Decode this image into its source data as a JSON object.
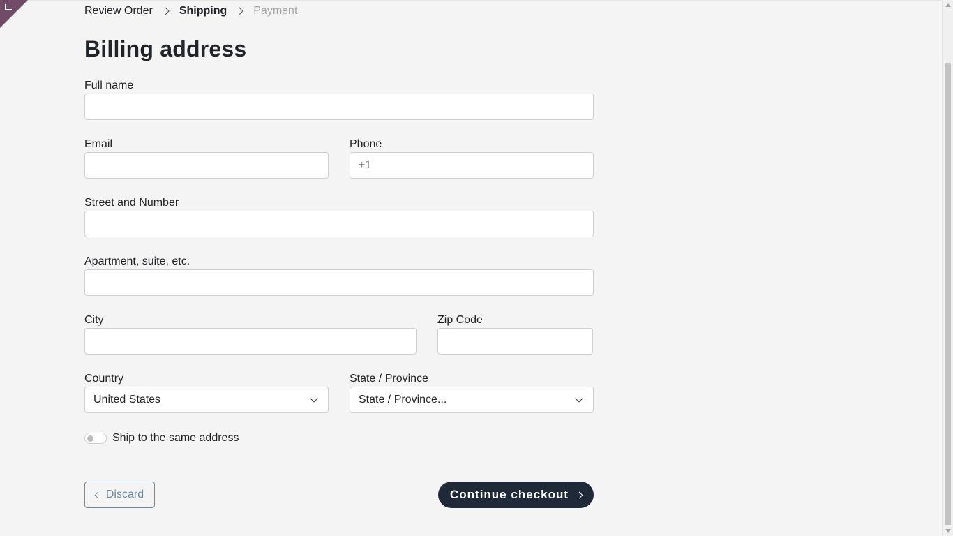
{
  "breadcrumb": {
    "items": [
      {
        "label": "Review Order"
      },
      {
        "label": "Shipping"
      },
      {
        "label": "Payment"
      }
    ]
  },
  "form": {
    "title": "Billing address",
    "full_name": {
      "label": "Full name",
      "value": "",
      "placeholder": ""
    },
    "email": {
      "label": "Email",
      "value": "",
      "placeholder": ""
    },
    "phone": {
      "label": "Phone",
      "value": "",
      "placeholder": "+1"
    },
    "street": {
      "label": "Street and Number",
      "value": "",
      "placeholder": ""
    },
    "apartment": {
      "label": "Apartment, suite, etc.",
      "value": "",
      "placeholder": ""
    },
    "city": {
      "label": "City",
      "value": "",
      "placeholder": ""
    },
    "zip": {
      "label": "Zip Code",
      "value": "",
      "placeholder": ""
    },
    "country": {
      "label": "Country",
      "selected": "United States"
    },
    "state": {
      "label": "State / Province",
      "selected": "State / Province..."
    },
    "ship_same": {
      "label": "Ship to the same address",
      "checked": false
    }
  },
  "actions": {
    "discard_label": "Discard",
    "continue_label": "Continue checkout"
  },
  "colors": {
    "accent": "#714b67",
    "button_dark": "#1f2937",
    "discard": "#6c8aa1",
    "background": "#f4f4f4"
  }
}
